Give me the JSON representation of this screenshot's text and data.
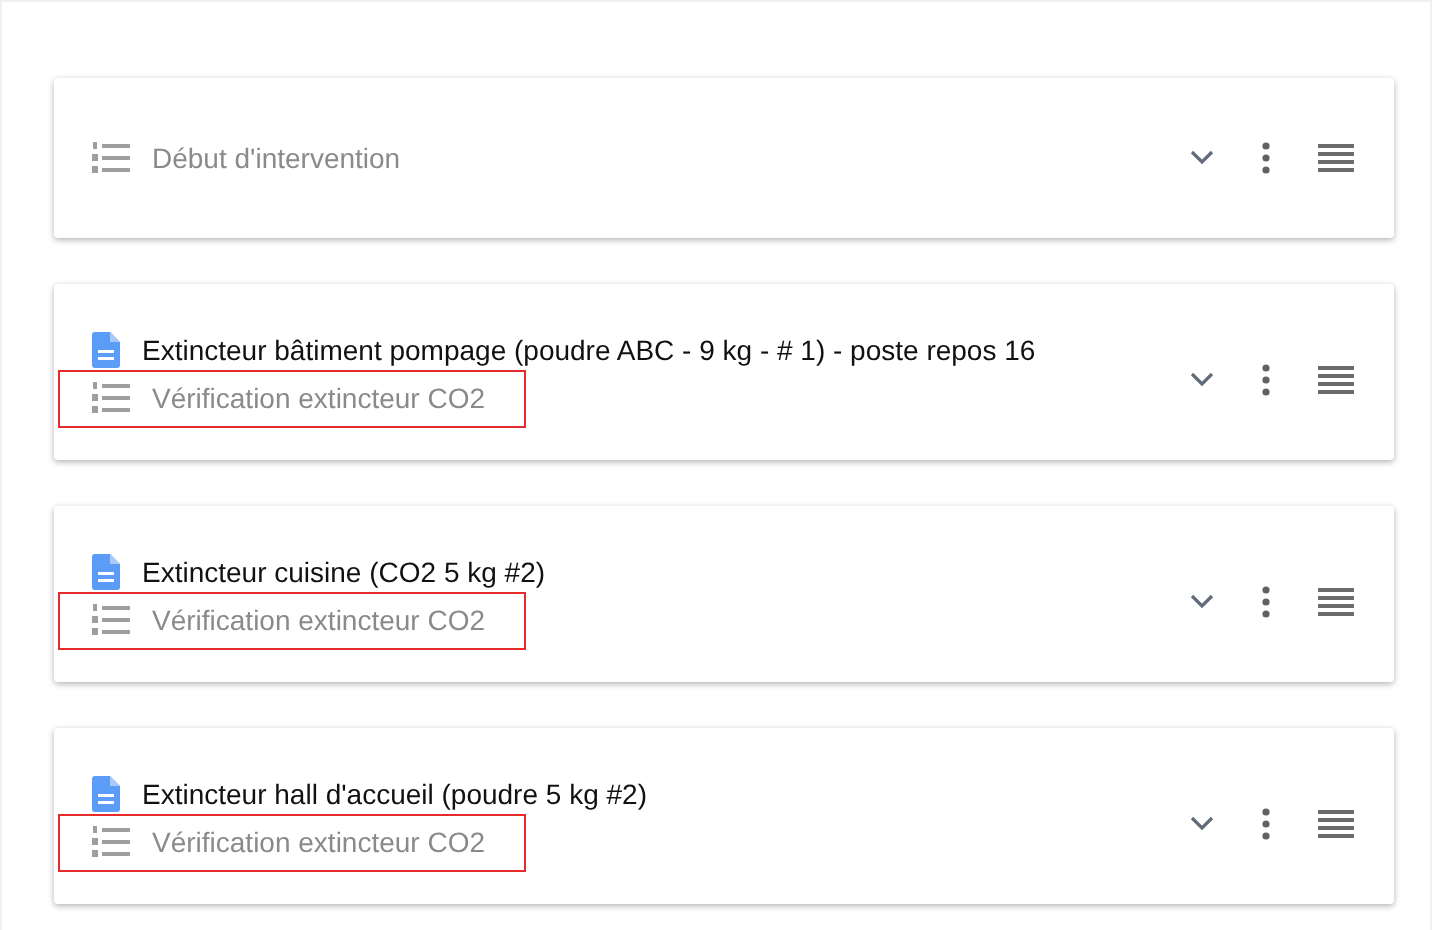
{
  "cards": [
    {
      "kind": "checklist",
      "checklist": "Début d'intervention",
      "highlighted": false
    },
    {
      "kind": "document",
      "document": "Extincteur bâtiment pompage (poudre ABC - 9 kg - # 1) - poste repos 16",
      "checklist": "Vérification extincteur CO2",
      "highlighted": true
    },
    {
      "kind": "document",
      "document": "Extincteur cuisine (CO2 5 kg #2)",
      "checklist": "Vérification extincteur CO2",
      "highlighted": true
    },
    {
      "kind": "document",
      "document": "Extincteur hall d'accueil (poudre 5 kg #2)",
      "checklist": "Vérification extincteur CO2",
      "highlighted": true
    }
  ]
}
